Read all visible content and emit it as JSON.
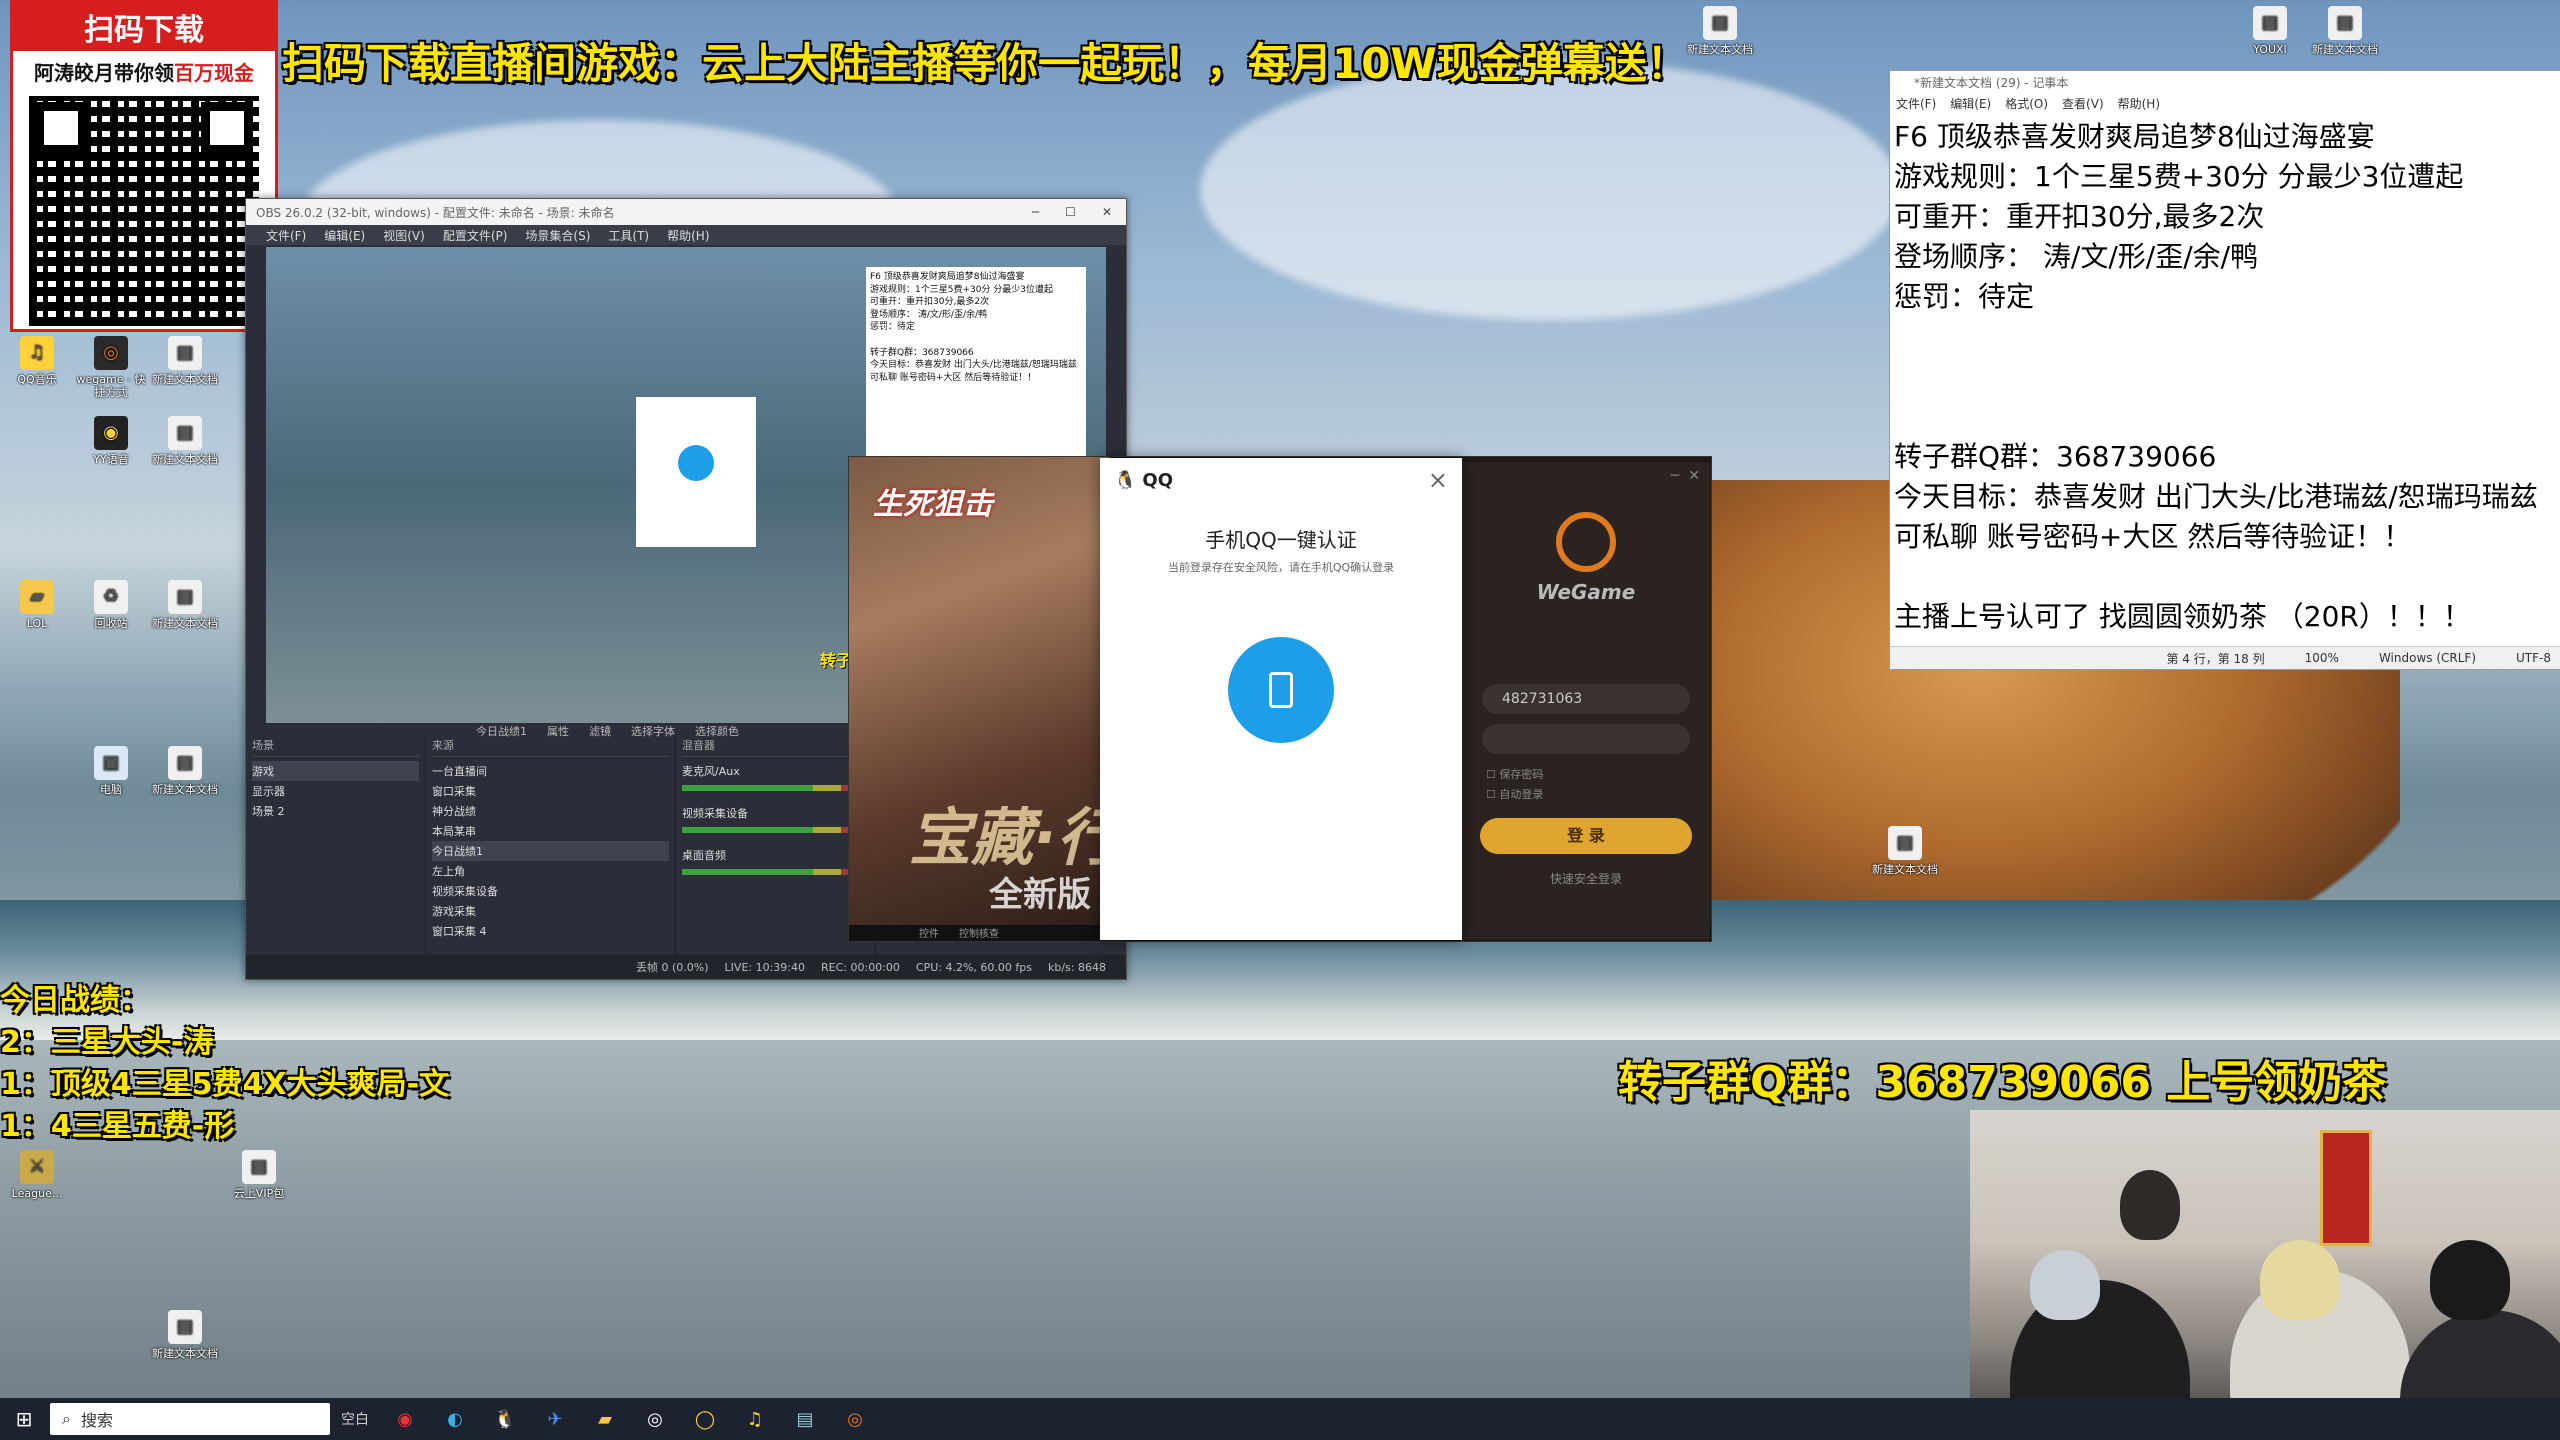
{
  "promo": {
    "title": "扫码下载",
    "line_prefix": "阿涛皎月带你领",
    "line_highlight": "百万现金"
  },
  "banner": "扫码下载直播间游戏：云上大陆主播等你一起玩！，每月10W现金弹幕送！",
  "desktop_icons": {
    "wegame": "wegame - 快捷方式",
    "qq_music": "QQ音乐",
    "yy": "YY语音",
    "lol": "LOL",
    "txt": "新建文本文档",
    "recycle": "回收站",
    "browser": "电脑",
    "league": "League...",
    "youxi": "YOUXI",
    "yunshang": "云上VIP包"
  },
  "obs": {
    "title": "OBS 26.0.2 (32-bit, windows) - 配置文件: 未命名 - 场景: 未命名",
    "menu": [
      "文件(F)",
      "编辑(E)",
      "视图(V)",
      "配置文件(P)",
      "场景集合(S)",
      "工具(T)",
      "帮助(H)"
    ],
    "preview_tag": "转子群Q",
    "panel_scene_header": "场景",
    "scenes": [
      "游戏",
      "显示器",
      "场景 2"
    ],
    "panel_source_header": "来源",
    "sources": [
      "一台直播间",
      "窗口采集",
      "神分战绩",
      "本局某串",
      "今日战绩1",
      "左上角",
      "视频采集设备",
      "游戏采集",
      "窗口采集 4"
    ],
    "panel_mixer_header": "混音器",
    "mixer": [
      "麦克风/Aux",
      "视频采集设备",
      "桌面音频"
    ],
    "current_source": "今日战绩1",
    "toolbar": [
      "属性",
      "滤镜",
      "选择字体",
      "选择颜色"
    ],
    "status": [
      "丢帧 0 (0.0%)",
      "LIVE: 10:39:40",
      "REC: 00:00:00",
      "CPU: 4.2%, 60.00 fps",
      "kb/s: 8648"
    ]
  },
  "game": {
    "logo": "生死狙击",
    "big": "宝藏·行",
    "sub": "全新版",
    "bottom": [
      "控件",
      "控制核查"
    ]
  },
  "wegame": {
    "name": "WeGame",
    "account": "482731063",
    "remember": "保存密码",
    "autologin": "自动登录",
    "login": "登 录",
    "safe": "快速安全登录"
  },
  "qq": {
    "brand": "QQ",
    "title": "手机QQ一键认证",
    "hint": "当前登录存在安全风险，请在手机QQ确认登录"
  },
  "notepad": {
    "title": "*新建文本文档 (29) - 记事本",
    "menu": [
      "文件(F)",
      "编辑(E)",
      "格式(O)",
      "查看(V)",
      "帮助(H)"
    ],
    "lines": [
      "F6 顶级恭喜发财爽局追梦8仙过海盛宴",
      "游戏规则：1个三星5费+30分 分最少3位遭起",
      "可重开：重开扣30分,最多2次",
      "登场顺序： 涛/文/形/歪/余/鸭",
      "惩罚：待定",
      "",
      "",
      "",
      "转子群Q群：368739066",
      "今天目标：恭喜发财 出门大头/比港瑞兹/恕瑞玛瑞兹",
      "可私聊 账号密码+大区 然后等待验证！！",
      "",
      "主播上号认可了 找圆圆领奶茶 （20R）！！！"
    ],
    "status": [
      "第 4 行，第 18 列",
      "100%",
      "Windows (CRLF)",
      "UTF-8"
    ]
  },
  "overlay_group": "转子群Q群：368739066 上号领奶茶",
  "record": {
    "title": "今日战绩：",
    "items": [
      "2：三星大头-涛",
      "1：顶级4三星5费4X大头爽局-文",
      "1：4三星五费-形"
    ]
  },
  "taskbar": {
    "search": "搜索",
    "empty_label": "空白"
  }
}
